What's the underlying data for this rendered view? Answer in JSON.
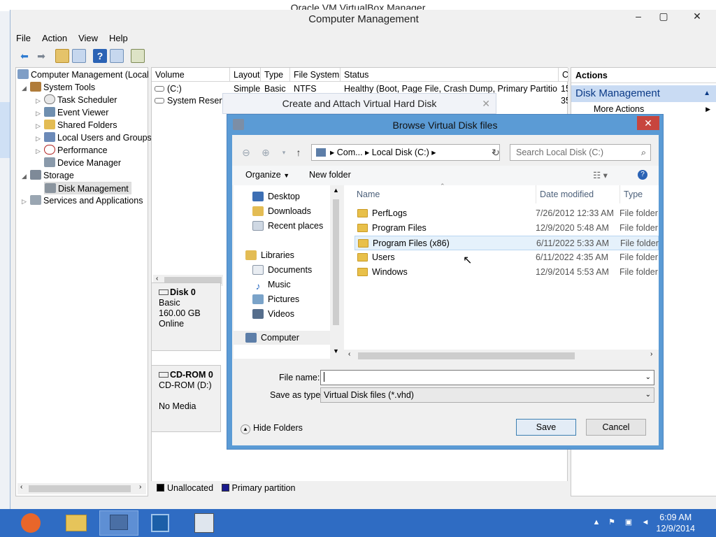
{
  "vbox": {
    "title": "Oracle VM VirtualBox Manager"
  },
  "cm": {
    "title": "Computer Management",
    "menu": [
      "File",
      "Action",
      "View",
      "Help"
    ],
    "tree": [
      {
        "label": "Computer Management (Local",
        "level": 0
      },
      {
        "label": "System Tools",
        "level": 1
      },
      {
        "label": "Task Scheduler",
        "level": 2
      },
      {
        "label": "Event Viewer",
        "level": 2
      },
      {
        "label": "Shared Folders",
        "level": 2
      },
      {
        "label": "Local Users and Groups",
        "level": 2
      },
      {
        "label": "Performance",
        "level": 2
      },
      {
        "label": "Device Manager",
        "level": 2
      },
      {
        "label": "Storage",
        "level": 1
      },
      {
        "label": "Disk Management",
        "level": 2
      },
      {
        "label": "Services and Applications",
        "level": 1
      }
    ],
    "columns": [
      "Volume",
      "Layout",
      "Type",
      "File System",
      "Status",
      "C"
    ],
    "volumes": [
      {
        "volume": "(C:)",
        "layout": "Simple",
        "type": "Basic",
        "fs": "NTFS",
        "status": "Healthy (Boot, Page File, Crash Dump, Primary Partition)",
        "cap": "15"
      },
      {
        "volume": "System Reserve",
        "layout": "",
        "type": "",
        "fs": "",
        "status": "",
        "cap": "35"
      }
    ],
    "disks": [
      {
        "name": "Disk 0",
        "l1": "Basic",
        "l2": "160.00 GB",
        "l3": "Online"
      },
      {
        "name": "CD-ROM 0",
        "l1": "CD-ROM (D:)",
        "l2": "",
        "l3": "No Media"
      }
    ],
    "legend": [
      {
        "label": "Unallocated",
        "color": "#000000"
      },
      {
        "label": "Primary partition",
        "color": "#1a1a8c"
      }
    ],
    "actions": {
      "header": "Actions",
      "section": "Disk Management",
      "more": "More Actions"
    }
  },
  "bg_dialog": {
    "title": "Create and Attach Virtual Hard Disk"
  },
  "dialog": {
    "title": "Browse Virtual Disk files",
    "address": [
      "Com...",
      "Local Disk (C:)"
    ],
    "search_placeholder": "Search Local Disk (C:)",
    "organize": "Organize",
    "new_folder": "New folder",
    "nav": [
      {
        "label": "Desktop",
        "group": "fav"
      },
      {
        "label": "Downloads",
        "group": "fav"
      },
      {
        "label": "Recent places",
        "group": "fav"
      },
      {
        "label": "Libraries",
        "group": "root"
      },
      {
        "label": "Documents",
        "group": "lib"
      },
      {
        "label": "Music",
        "group": "lib"
      },
      {
        "label": "Pictures",
        "group": "lib"
      },
      {
        "label": "Videos",
        "group": "lib"
      },
      {
        "label": "Computer",
        "group": "root"
      }
    ],
    "columns": [
      "Name",
      "Date modified",
      "Type"
    ],
    "files": [
      {
        "name": "PerfLogs",
        "date": "7/26/2012 12:33 AM",
        "type": "File folder"
      },
      {
        "name": "Program Files",
        "date": "12/9/2020 5:48 AM",
        "type": "File folder"
      },
      {
        "name": "Program Files (x86)",
        "date": "6/11/2022 5:33 AM",
        "type": "File folder"
      },
      {
        "name": "Users",
        "date": "6/11/2022 4:35 AM",
        "type": "File folder"
      },
      {
        "name": "Windows",
        "date": "12/9/2014 5:53 AM",
        "type": "File folder"
      }
    ],
    "file_name_label": "File name:",
    "file_name_value": "",
    "save_type_label": "Save as type:",
    "save_type_value": "Virtual Disk files (*.vhd)",
    "hide_folders": "Hide Folders",
    "save": "Save",
    "cancel": "Cancel"
  },
  "taskbar": {
    "time": "6:09 AM",
    "date": "12/9/2014"
  }
}
